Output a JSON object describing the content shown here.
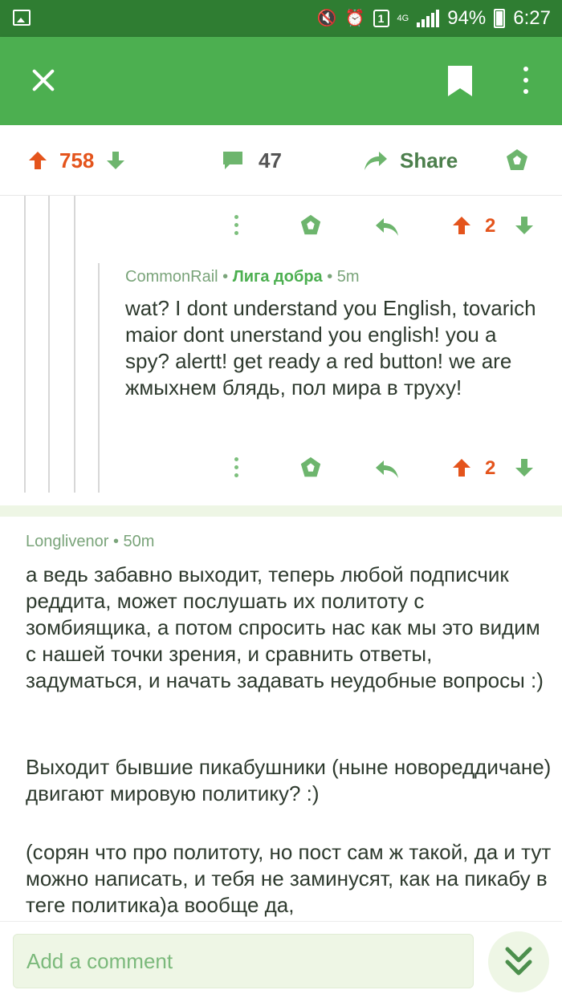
{
  "status_bar": {
    "battery_text": "94%",
    "time": "6:27",
    "network": "4G",
    "sim": "1"
  },
  "post_actions": {
    "votes": "758",
    "comments": "47",
    "share_label": "Share"
  },
  "thread": {
    "parent_actions": {
      "vote_count": "2"
    },
    "reply": {
      "author": "CommonRail",
      "flair": "Лига добра",
      "time": "5m",
      "text": "wat? I dont understand you English, tovarich maior dont unerstand you english! you a spy? alertt! get ready a red button! we are жмыхнем блядь, пол мира в труху!",
      "vote_count": "2"
    }
  },
  "comment": {
    "author": "Longlivenor",
    "time": "50m",
    "paragraphs": [
      "а ведь забавно выходит, теперь любой подписчик реддита, может послушать их политоту с зомбиящика, а потом спросить нас как мы это видим с нашей точки зрения, и сравнить ответы, задуматься, и начать задавать неудобные вопросы :)",
      "Выходит бывшие пикабушники (ныне новореддичане) двигают мировую политику? :)",
      "(сорян что про политоту, но пост сам ж такой, да и тут можно написать, и тебя не заминусят, как на пикабу в теге политика)а вообще да,"
    ]
  },
  "bottom": {
    "input_placeholder": "Add a comment"
  },
  "colors": {
    "app_bar": "#4caf50",
    "status_bar": "#2f7d32",
    "upvote": "#e4541c",
    "accent_green": "#4caf50"
  }
}
